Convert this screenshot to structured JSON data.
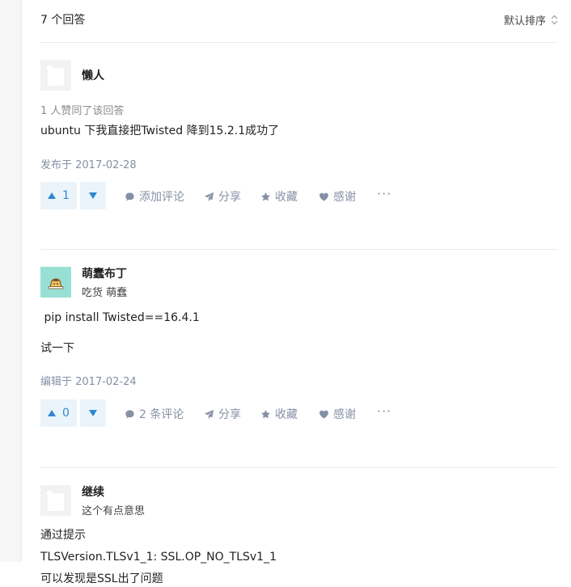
{
  "header": {
    "answers_count": "7 个回答",
    "sort_label": "默认排序"
  },
  "answers": [
    {
      "author": "懒人",
      "bio": "",
      "upvote_info": "1 人赞同了该回答",
      "lines": [
        "ubuntu 下我直接把Twisted 降到15.2.1成功了"
      ],
      "date": "发布于 2017-02-28",
      "votes": "1",
      "comment_label": "添加评论"
    },
    {
      "author": "萌蠢布丁",
      "bio": "吃货 萌蠢",
      "upvote_info": "",
      "lines": [
        " pip install Twisted==16.4.1",
        "试一下"
      ],
      "date": "编辑于 2017-02-24",
      "votes": "0",
      "comment_label": "2 条评论"
    },
    {
      "author": "继续",
      "bio": "这个有点意思",
      "upvote_info": "",
      "lines": [
        "通过提示",
        "TLSVersion.TLSv1_1: SSL.OP_NO_TLSv1_1",
        "可以发现是SSL出了问题"
      ]
    }
  ],
  "actions": {
    "share": "分享",
    "collect": "收藏",
    "thank": "感谢",
    "more": "···"
  },
  "colors": {
    "vote_bg": "#ebf4fb",
    "vote_fg": "#2e87d1",
    "meta_gray": "#8590a6",
    "avatar_pudding_bg": "#98e0d4"
  },
  "icons": {
    "comment": "speech-bubble-icon",
    "share": "paper-plane-icon",
    "collect": "star-icon",
    "thank": "heart-icon",
    "more": "ellipsis-icon"
  }
}
